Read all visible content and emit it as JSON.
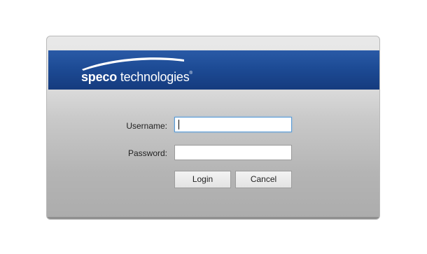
{
  "brand": {
    "name_bold": "speco",
    "name_light": " technologies",
    "trademark": "®",
    "banner_color": "#1d4b95"
  },
  "form": {
    "username_label": "Username:",
    "username_value": "",
    "password_label": "Password:",
    "password_value": "",
    "login_label": "Login",
    "cancel_label": "Cancel"
  }
}
